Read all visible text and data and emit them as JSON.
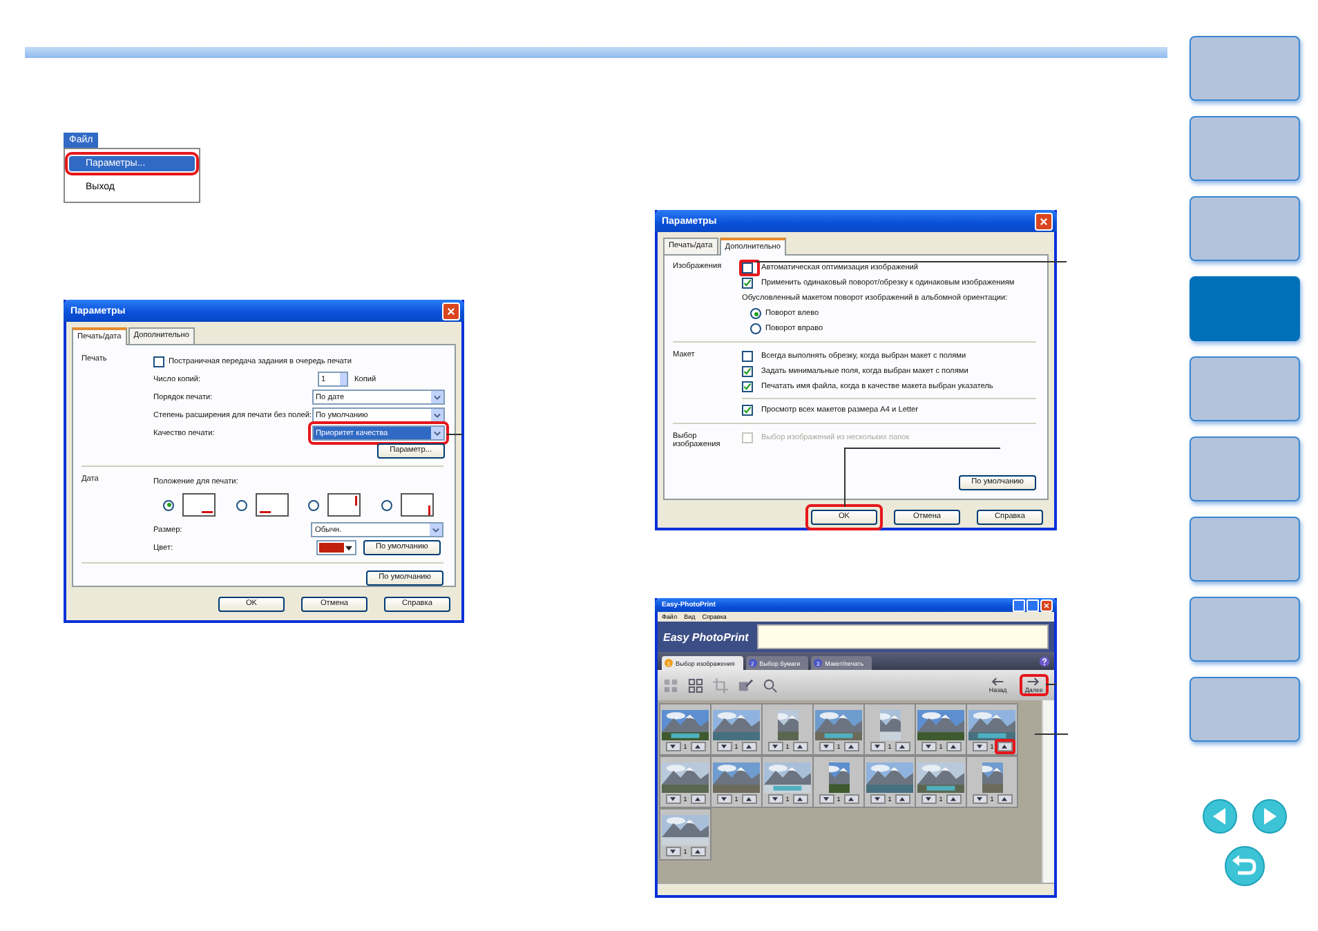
{
  "menu": {
    "title": "Файл",
    "items": [
      {
        "label": "Параметры...",
        "selected": true,
        "callout": true
      },
      {
        "label": "Выход",
        "selected": false,
        "callout": false
      }
    ]
  },
  "dialog1": {
    "title": "Параметры",
    "tabs": [
      {
        "label": "Печать/дата",
        "selected": true
      },
      {
        "label": "Дополнительно",
        "selected": false
      }
    ],
    "print_section": {
      "label": "Печать",
      "checkbox": {
        "label": "Постраничная передача задания в очередь печати",
        "checked": false
      },
      "copies": {
        "label": "Число копий:",
        "value": "1",
        "unit": "Копий"
      },
      "fields": [
        {
          "label": "Порядок печати:",
          "value": "По дате",
          "callout": false
        },
        {
          "label": "Степень расширения для печати без полей:",
          "value": "По умолчанию",
          "callout": false
        },
        {
          "label": "Качество печати:",
          "value": "Приоритет качества",
          "callout": true
        }
      ],
      "settings_button": "Параметр..."
    },
    "date_section": {
      "label": "Дата",
      "position_label": "Положение для печати:",
      "positions": [
        {
          "kind": "bottom-right",
          "selected": true
        },
        {
          "kind": "bottom-left",
          "selected": false
        },
        {
          "kind": "right-top",
          "selected": false
        },
        {
          "kind": "right-bottom",
          "selected": false
        }
      ],
      "size": {
        "label": "Размер:",
        "value": "Обычн."
      },
      "color": {
        "label": "Цвет:",
        "color": "#c0200c"
      },
      "default_button": "По умолчанию"
    },
    "default_button": "По умолчанию",
    "buttons": [
      {
        "label": "OK",
        "callout": false
      },
      {
        "label": "Отмена",
        "callout": false
      },
      {
        "label": "Справка",
        "callout": false
      }
    ]
  },
  "dialog2": {
    "title": "Параметры",
    "tabs": [
      {
        "label": "Печать/дата",
        "selected": false
      },
      {
        "label": "Дополнительно",
        "selected": true
      }
    ],
    "sections": [
      {
        "label": "Изображения",
        "options": [
          {
            "kind": "checkbox",
            "label": "Автоматическая оптимизация изображений",
            "checked": false,
            "disabled": false,
            "callout": true
          },
          {
            "kind": "checkbox",
            "label": "Применить одинаковый поворот/обрезку к одинаковым изображениям",
            "checked": true,
            "disabled": false,
            "callout": false
          },
          {
            "kind": "note",
            "label": "Обусловленный макетом поворот изображений в альбомной ориентации:"
          },
          {
            "kind": "radio",
            "label": "Поворот влево",
            "selected": true
          },
          {
            "kind": "radio",
            "label": "Поворот вправо",
            "selected": false
          }
        ]
      },
      {
        "label": "Макет",
        "options": [
          {
            "kind": "checkbox",
            "label": "Всегда выполнять обрезку, когда выбран макет с полями",
            "checked": false,
            "disabled": false,
            "callout": false
          },
          {
            "kind": "checkbox",
            "label": "Задать минимальные поля, когда выбран макет с полями",
            "checked": true,
            "disabled": false,
            "callout": false
          },
          {
            "kind": "checkbox",
            "label": "Печатать имя файла, когда в качестве макета выбран указатель",
            "checked": true,
            "disabled": false,
            "callout": false
          },
          {
            "kind": "divider"
          },
          {
            "kind": "checkbox",
            "label": "Просмотр всех макетов размера A4 и Letter",
            "checked": true,
            "disabled": false,
            "callout": false
          }
        ]
      },
      {
        "label": "Выбор изображения",
        "options": [
          {
            "kind": "checkbox",
            "label": "Выбор изображений из нескольких папок",
            "checked": false,
            "disabled": true,
            "callout": false
          }
        ]
      }
    ],
    "default_button": "По умолчанию",
    "buttons": [
      {
        "label": "OK",
        "callout": true
      },
      {
        "label": "Отмена",
        "callout": false
      },
      {
        "label": "Справка",
        "callout": false
      }
    ]
  },
  "app": {
    "title": "Easy-PhotoPrint",
    "menu": [
      "Файл",
      "Вид",
      "Справка"
    ],
    "logo": "Easy PhotoPrint",
    "tabs": [
      {
        "number": "1",
        "label": "Выбор изображения",
        "selected": true
      },
      {
        "number": "2",
        "label": "Выбор бумаги",
        "selected": false
      },
      {
        "number": "3",
        "label": "Макет/печать",
        "selected": false
      }
    ],
    "tools": [
      {
        "kind": "grid",
        "disabled": true
      },
      {
        "kind": "clear",
        "disabled": false
      },
      {
        "kind": "crop",
        "disabled": true
      },
      {
        "kind": "edit",
        "disabled": false
      },
      {
        "kind": "effects",
        "disabled": false
      }
    ],
    "back_button": "Назад",
    "next_button": "Далее",
    "photos": [
      {
        "copies": "1",
        "callout": false
      },
      {
        "copies": "1",
        "callout": false
      },
      {
        "copies": "1",
        "callout": false
      },
      {
        "copies": "1",
        "callout": false
      },
      {
        "copies": "1",
        "callout": false
      },
      {
        "copies": "1",
        "callout": false
      },
      {
        "copies": "1",
        "callout": true
      },
      {
        "copies": "1",
        "callout": false
      },
      {
        "copies": "1",
        "callout": false
      },
      {
        "copies": "1",
        "callout": false
      },
      {
        "copies": "1",
        "callout": false
      },
      {
        "copies": "1",
        "callout": false
      },
      {
        "copies": "1",
        "callout": false
      },
      {
        "copies": "1",
        "callout": false
      },
      {
        "copies": "1",
        "callout": false
      }
    ]
  },
  "nav": [
    {
      "selected": false
    },
    {
      "selected": false
    },
    {
      "selected": false
    },
    {
      "selected": true
    },
    {
      "selected": false
    },
    {
      "selected": false
    },
    {
      "selected": false
    },
    {
      "selected": false
    },
    {
      "selected": false
    }
  ]
}
